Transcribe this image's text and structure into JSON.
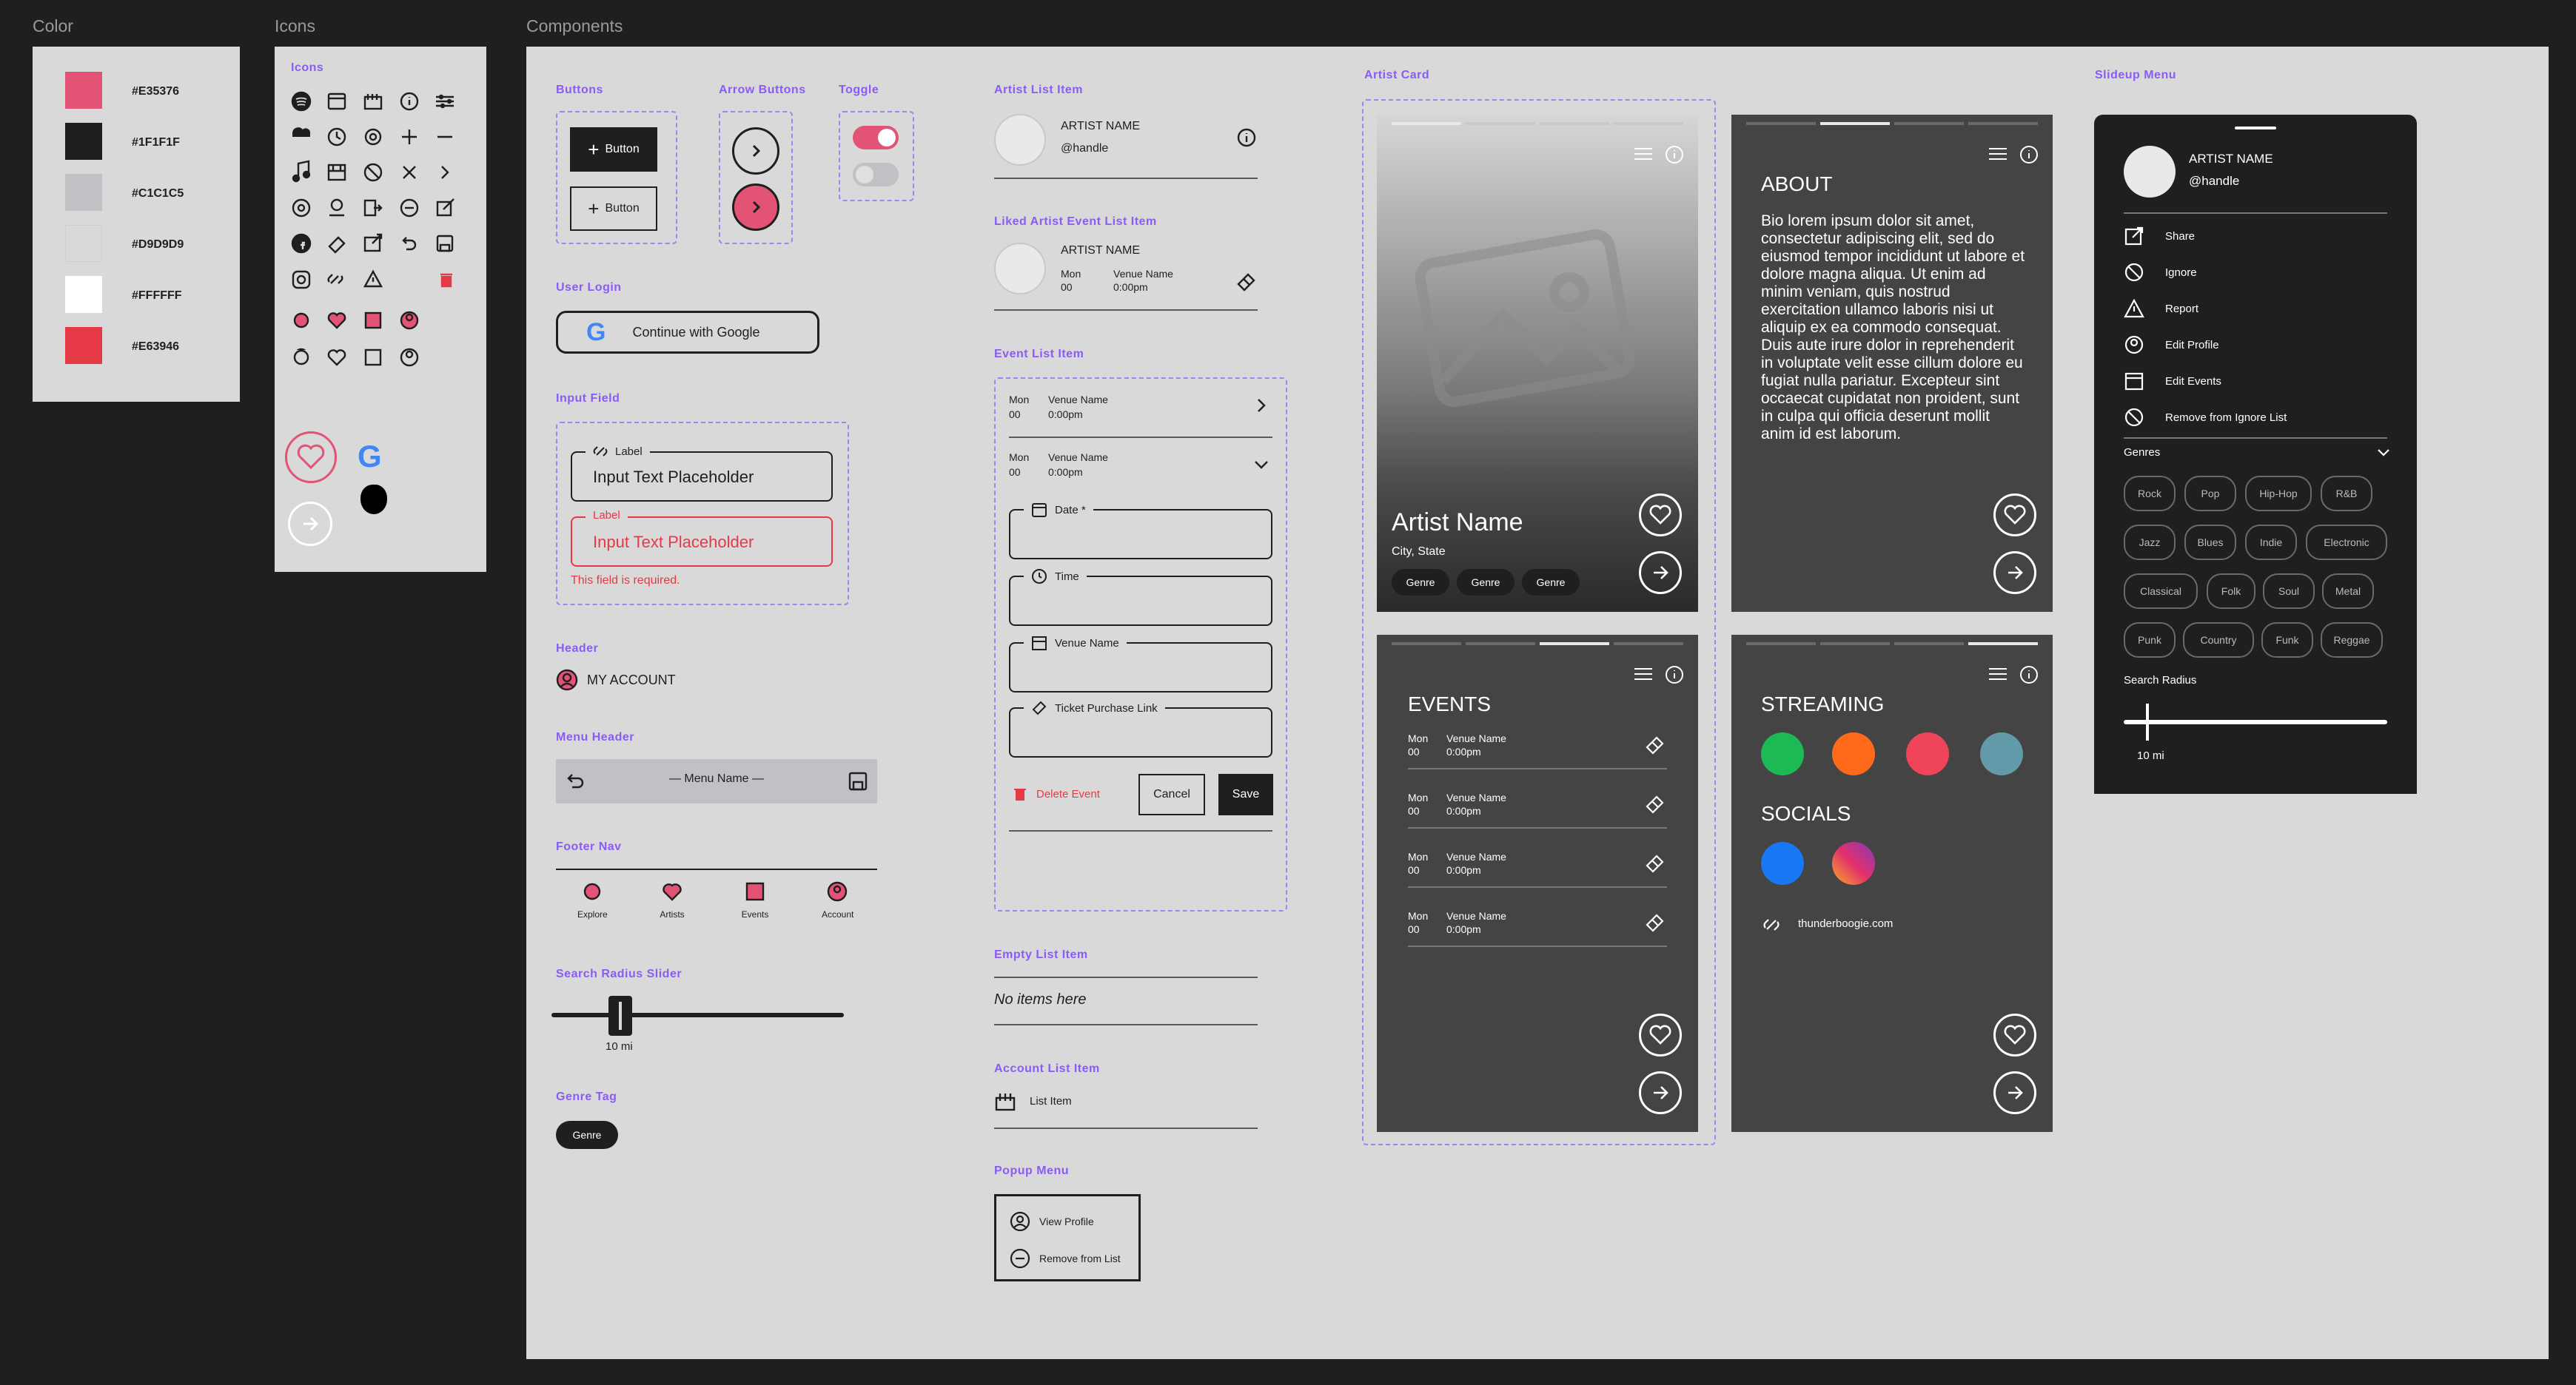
{
  "sections": {
    "color": "Color",
    "icons": "Icons",
    "components": "Components"
  },
  "colors": [
    {
      "hex": "#E35376",
      "label": "#E35376"
    },
    {
      "hex": "#1F1F1F",
      "label": "#1F1F1F"
    },
    {
      "hex": "#C1C1C5",
      "label": "#C1C1C5"
    },
    {
      "hex": "#D9D9D9",
      "label": "#D9D9D9"
    },
    {
      "hex": "#FFFFFF",
      "label": "#FFFFFF"
    },
    {
      "hex": "#E63946",
      "label": "#E63946"
    }
  ],
  "icons_panel": {
    "label": "Icons"
  },
  "buttons": {
    "label": "Buttons",
    "primary": "Button",
    "secondary": "Button"
  },
  "arrow_buttons": {
    "label": "Arrow Buttons"
  },
  "toggle": {
    "label": "Toggle"
  },
  "user_login": {
    "label": "User Login",
    "google": "Continue with Google"
  },
  "input_field": {
    "label": "Input Field",
    "field_label": "Label",
    "placeholder": "Input Text Placeholder",
    "error_label": "Label",
    "error_placeholder": "Input Text Placeholder",
    "error_text": "This field is required."
  },
  "header": {
    "label": "Header",
    "text": "MY ACCOUNT"
  },
  "menu_header": {
    "label": "Menu Header",
    "title": "Menu Name"
  },
  "footer_nav": {
    "label": "Footer Nav",
    "items": [
      "Explore",
      "Artists",
      "Events",
      "Account"
    ]
  },
  "search_slider": {
    "label": "Search Radius Slider",
    "value": "10 mi"
  },
  "genre_tag": {
    "label": "Genre Tag",
    "text": "Genre"
  },
  "artist_list_item": {
    "label": "Artist List Item",
    "name": "ARTIST NAME",
    "handle": "@handle"
  },
  "liked_event": {
    "label": "Liked Artist Event List Item",
    "name": "ARTIST NAME",
    "day": "Mon",
    "date": "00",
    "venue": "Venue Name",
    "time": "0:00pm"
  },
  "event_list_item": {
    "label": "Event List Item",
    "day": "Mon",
    "date": "00",
    "venue": "Venue Name",
    "time": "0:00pm",
    "f_date": "Date *",
    "f_time": "Time",
    "f_venue": "Venue Name",
    "f_ticket": "Ticket Purchase Link",
    "delete": "Delete Event",
    "cancel": "Cancel",
    "save": "Save"
  },
  "empty_list": {
    "label": "Empty List Item",
    "text": "No items here"
  },
  "account_list": {
    "label": "Account List Item",
    "text": "List Item"
  },
  "popup_menu": {
    "label": "Popup Menu",
    "items": [
      "View Profile",
      "Remove from List"
    ]
  },
  "artist_card": {
    "label": "Artist Card",
    "name": "Artist Name",
    "location": "City, State",
    "genres": [
      "Genre",
      "Genre",
      "Genre"
    ],
    "about_title": "ABOUT",
    "about_body": "Bio lorem ipsum dolor sit amet, consectetur adipiscing elit, sed do eiusmod tempor incididunt ut labore et dolore magna aliqua. Ut enim ad minim veniam, quis nostrud exercitation ullamco laboris nisi ut aliquip ex ea commodo consequat. Duis aute irure dolor in reprehenderit in voluptate velit esse cillum dolore eu fugiat nulla pariatur. Excepteur sint occaecat cupidatat non proident, sunt in culpa qui officia deserunt mollit anim id est laborum.",
    "events_title": "EVENTS",
    "events": [
      {
        "day": "Mon",
        "date": "00",
        "venue": "Venue Name",
        "time": "0:00pm"
      },
      {
        "day": "Mon",
        "date": "00",
        "venue": "Venue Name",
        "time": "0:00pm"
      },
      {
        "day": "Mon",
        "date": "00",
        "venue": "Venue Name",
        "time": "0:00pm"
      },
      {
        "day": "Mon",
        "date": "00",
        "venue": "Venue Name",
        "time": "0:00pm"
      }
    ],
    "streaming_title": "STREAMING",
    "socials_title": "SOCIALS",
    "website": "thunderboogie.com"
  },
  "slideup": {
    "label": "Slideup Menu",
    "name": "ARTIST NAME",
    "handle": "@handle",
    "items": [
      "Share",
      "Ignore",
      "Report",
      "Edit Profile",
      "Edit Events",
      "Remove from Ignore List"
    ],
    "genres_label": "Genres",
    "genres": [
      "Rock",
      "Pop",
      "Hip-Hop",
      "R&B",
      "Jazz",
      "Blues",
      "Indie",
      "Electronic",
      "Classical",
      "Folk",
      "Soul",
      "Metal",
      "Punk",
      "Country",
      "Funk",
      "Reggae"
    ],
    "radius_label": "Search Radius",
    "radius_value": "10 mi"
  }
}
